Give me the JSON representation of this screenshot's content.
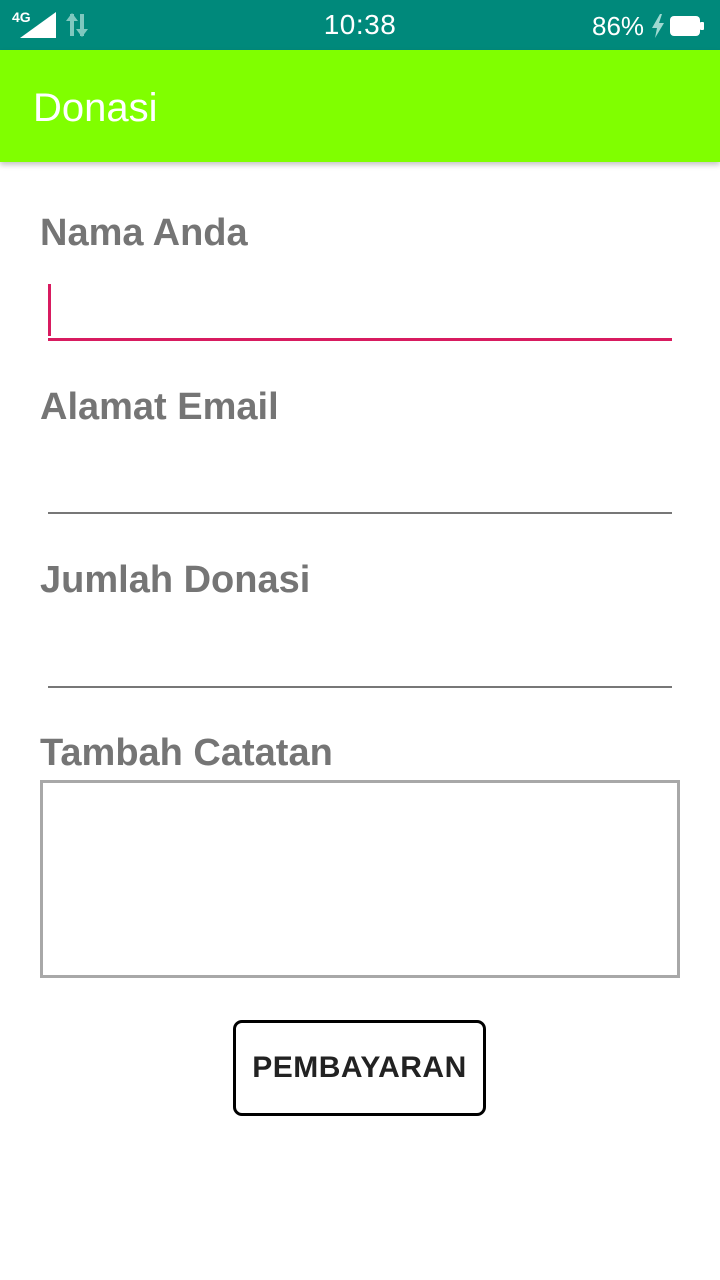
{
  "status_bar": {
    "network_type": "4G",
    "time": "10:38",
    "battery": "86%",
    "icons": [
      "signal-icon",
      "data-transfer-icon",
      "charging-bolt-icon",
      "battery-icon"
    ]
  },
  "app_bar": {
    "title": "Donasi",
    "color": "#80ff00"
  },
  "form": {
    "name_label": "Nama Anda",
    "name_value": "",
    "email_label": "Alamat Email",
    "email_value": "",
    "amount_label": "Jumlah Donasi",
    "amount_value": "",
    "notes_label": "Tambah Catatan",
    "notes_value": "",
    "focus_color": "#d81b60"
  },
  "actions": {
    "pay_label": "PEMBAYARAN"
  }
}
